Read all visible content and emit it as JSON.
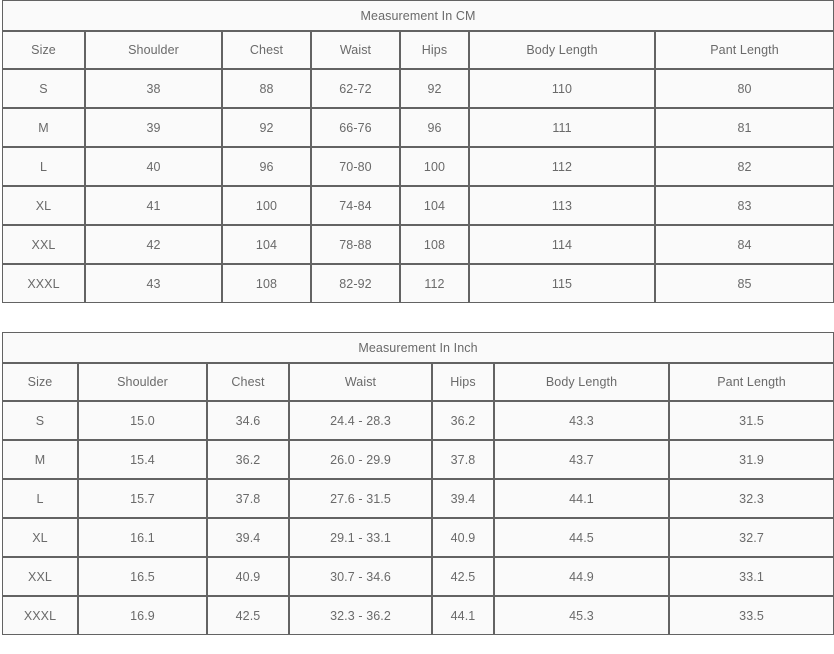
{
  "tables": [
    {
      "id": "cm",
      "title": "Measurement In CM",
      "columns": [
        "Size",
        "Shoulder",
        "Chest",
        "Waist",
        "Hips",
        "Body Length",
        "Pant Length"
      ],
      "rows": [
        [
          "S",
          "38",
          "88",
          "62-72",
          "92",
          "110",
          "80"
        ],
        [
          "M",
          "39",
          "92",
          "66-76",
          "96",
          "111",
          "81"
        ],
        [
          "L",
          "40",
          "96",
          "70-80",
          "100",
          "112",
          "82"
        ],
        [
          "XL",
          "41",
          "100",
          "74-84",
          "104",
          "113",
          "83"
        ],
        [
          "XXL",
          "42",
          "104",
          "78-88",
          "108",
          "114",
          "84"
        ],
        [
          "XXXL",
          "43",
          "108",
          "82-92",
          "112",
          "115",
          "85"
        ]
      ]
    },
    {
      "id": "inch",
      "title": "Measurement In Inch",
      "columns": [
        "Size",
        "Shoulder",
        "Chest",
        "Waist",
        "Hips",
        "Body Length",
        "Pant Length"
      ],
      "rows": [
        [
          "S",
          "15.0",
          "34.6",
          "24.4 - 28.3",
          "36.2",
          "43.3",
          "31.5"
        ],
        [
          "M",
          "15.4",
          "36.2",
          "26.0 - 29.9",
          "37.8",
          "43.7",
          "31.9"
        ],
        [
          "L",
          "15.7",
          "37.8",
          "27.6 - 31.5",
          "39.4",
          "44.1",
          "32.3"
        ],
        [
          "XL",
          "16.1",
          "39.4",
          "29.1 - 33.1",
          "40.9",
          "44.5",
          "32.7"
        ],
        [
          "XXL",
          "16.5",
          "40.9",
          "30.7 - 34.6",
          "42.5",
          "44.9",
          "33.1"
        ],
        [
          "XXXL",
          "16.9",
          "42.5",
          "32.3 - 36.2",
          "44.1",
          "45.3",
          "33.5"
        ]
      ]
    }
  ],
  "colors": {
    "title_background": "#e8e8e8",
    "header_background": "#f7f7f7",
    "cell_background": "#fdfdfd",
    "border": "#636363",
    "text": "#6f6f6f",
    "size_text": "#5e5e5e"
  }
}
